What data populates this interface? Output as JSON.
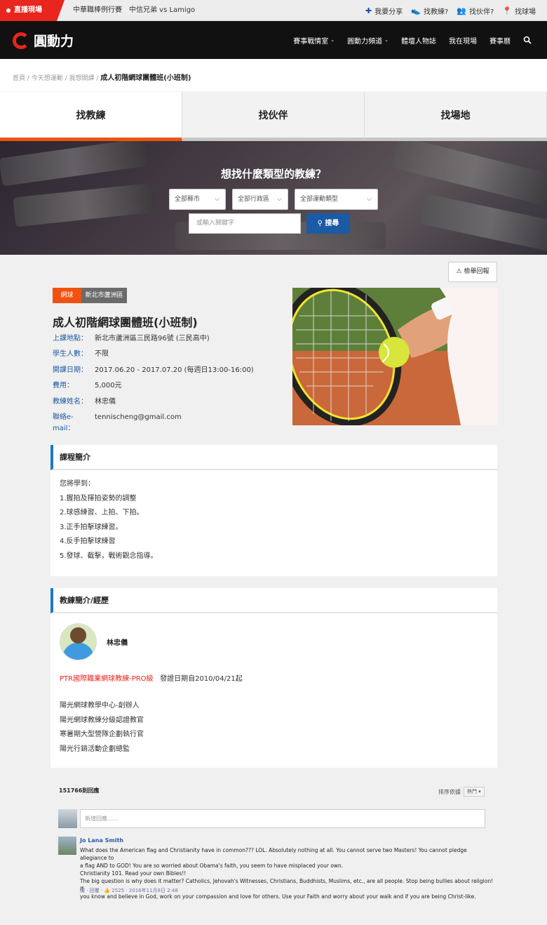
{
  "topbar": {
    "live_label": "直播現場",
    "live_match": "中華職棒例行賽　中信兄弟 vs Lamigo",
    "links": [
      {
        "icon": "plus-icon",
        "label": "我要分享"
      },
      {
        "icon": "shoe-icon",
        "label": "找教練?"
      },
      {
        "icon": "people-icon",
        "label": "找伙伴?"
      },
      {
        "icon": "location-pin-icon",
        "label": "找球場"
      }
    ]
  },
  "nav": {
    "logo_text": "圓動力",
    "items": [
      "賽事戰情室",
      "圓動力頻道",
      "體壇人物誌",
      "我在現場",
      "賽事曆"
    ],
    "search_icon": "search-icon"
  },
  "breadcrumb": {
    "path": "首頁 / 今天想運動 / 我想開課 /",
    "current": "成人初階網球團體班(小班制)"
  },
  "tabs": [
    "找教練",
    "找伙伴",
    "找場地"
  ],
  "search": {
    "title": "想找什麼類型的教練？",
    "county": "全部縣市",
    "district": "全部行政區",
    "sport": "全部運動類型",
    "keyword_placeholder": "或輸入關鍵字",
    "button": "搜尋"
  },
  "report_label": "檢舉回報",
  "course": {
    "tag_sport": "網球",
    "tag_area": "新北市蘆洲區",
    "title": "成人初階網球團體班(小班制)",
    "info": [
      {
        "label": "上課地點：",
        "value": "新北市蘆洲區三民路96號 (三民高中)"
      },
      {
        "label": "學生人數：",
        "value": "不限"
      },
      {
        "label": "開課日期：",
        "value": "2017.06.20 - 2017.07.20 (每週日13:00-16:00)"
      },
      {
        "label": "費用：",
        "value": "5,000元"
      },
      {
        "label": "教練姓名：",
        "value": "林忠儀"
      },
      {
        "label": "聯絡e-mail：",
        "value": "tennischeng@gmail.com"
      }
    ]
  },
  "intro": {
    "heading": "課程簡介",
    "lines": [
      "您將學到：",
      "1.握拍及揮拍姿勢的調整",
      "2.球感練習、上拍、下拍。",
      "3.正手拍擊球練習。",
      "4.反手拍擊球練習",
      "5.發球、截擊，戰術觀念指導。"
    ]
  },
  "coach": {
    "heading": "教練簡介/經歷",
    "name": "林忠儀",
    "cert": "PTR國際職業網球教練-PRO級",
    "cert_date": "發證日期自2010/04/21起",
    "experience": [
      "陽光網球教學中心-創辦人",
      "陽光網球教練分級認證教官",
      "寒暑期大型營隊企劃執行官",
      "陽光行銷活動企劃總監"
    ]
  },
  "comments": {
    "count_label": "151766則回應",
    "sort_label": "排序依據",
    "sort_value": "熱門",
    "input_placeholder": "新增回應……",
    "items": [
      {
        "author": "Jo Lana Smith",
        "lines": [
          "What does the American flag and Christianity have in common??? LOL. Absolutely nothing at all. You cannot serve two Masters! You cannot pledge allegiance to",
          "a flag AND to GOD! You are so worried about Obama's faith, you seem to have misplaced your own.",
          "Christianity 101. Read your own Bibles!!",
          "The big question is why does it matter? Catholics, Jehovah's Witnesses, Christians, Buddhists, Muslims, etc., are all people. Stop being bullies about religion! If",
          "you know and believe in God, work on your compassion and love for others. Use your Faith and worry about your walk and if you are being Christ-like."
        ],
        "meta": "讚 · 回覆 · 👍 2525 · 2016年11月8日 2:48"
      }
    ]
  }
}
